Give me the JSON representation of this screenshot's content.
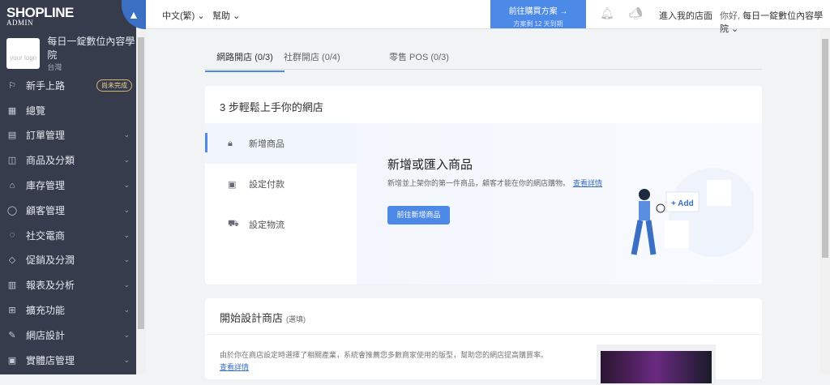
{
  "logo": {
    "brand": "SHOPLINE",
    "sub": "ADMIN"
  },
  "store": {
    "name": "每日一錠數位內容學院",
    "location": "台灣",
    "logo_placeholder": "your logo"
  },
  "sidebar": {
    "items": [
      {
        "label": "新手上路",
        "icon": "flag-icon",
        "badge": "尚未完成"
      },
      {
        "label": "總覽",
        "icon": "dashboard-icon"
      },
      {
        "label": "訂單管理",
        "icon": "order-icon"
      },
      {
        "label": "商品及分類",
        "icon": "bag-icon"
      },
      {
        "label": "庫存管理",
        "icon": "warehouse-icon"
      },
      {
        "label": "顧客管理",
        "icon": "user-icon"
      },
      {
        "label": "社交電商",
        "icon": "chat-icon"
      },
      {
        "label": "促銷及分潤",
        "icon": "tag-icon"
      },
      {
        "label": "報表及分析",
        "icon": "chart-icon"
      },
      {
        "label": "擴充功能",
        "icon": "apps-icon"
      },
      {
        "label": "網店設計",
        "icon": "brush-icon"
      },
      {
        "label": "實體店管理",
        "icon": "store-icon"
      }
    ]
  },
  "topbar": {
    "language": "中文(繁)",
    "help": "幫助",
    "buy_label": "前往購買方案 →",
    "plan_note": "方案剩 12 天到期",
    "visit_store": "進入我的店面",
    "greeting": "你好, ",
    "user": "每日一錠數位內容學院"
  },
  "tabs": [
    {
      "label": "網路開店 (0/3)"
    },
    {
      "label": "社群開店 (0/4)"
    },
    {
      "label": "零售 POS (0/3)"
    }
  ],
  "setup": {
    "title": "3 步輕鬆上手你的網店",
    "steps": [
      {
        "label": "新增商品"
      },
      {
        "label": "設定付款"
      },
      {
        "label": "設定物流"
      }
    ],
    "panel": {
      "title": "新增或匯入商品",
      "desc": "新增並上架你的第一件商品，顧客才能在你的網店購物。",
      "link": "查看詳情",
      "button": "前往新增商品",
      "add_label": "+ Add"
    }
  },
  "design": {
    "title": "開始設計商店",
    "optional": "(選填)",
    "desc": "由於你在商店設定時選擇了相關產業，系統會推薦您多數商家使用的版型，幫助您的網店提高購買率。",
    "link": "查看詳情"
  }
}
